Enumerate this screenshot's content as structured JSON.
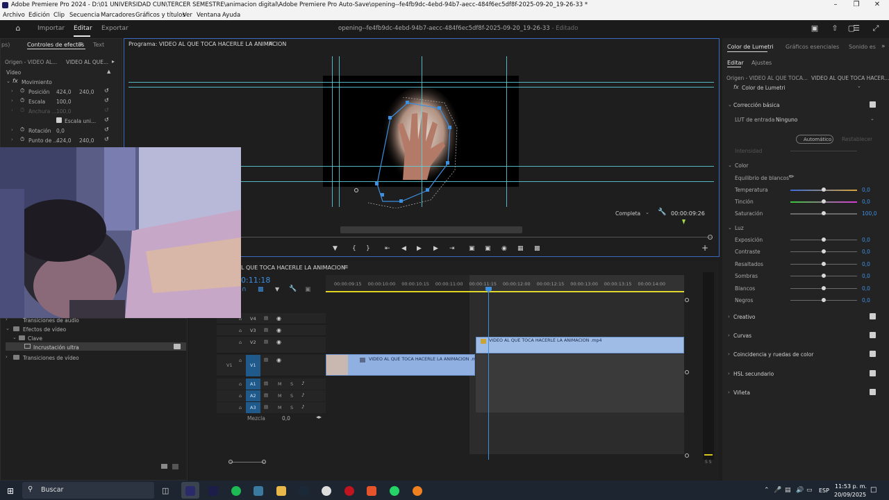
{
  "window": {
    "title": "Adobe Premiere Pro 2024 - D:\\01 UNIVERSIDAD CUN\\TERCER SEMESTRE\\animacion digital\\Adobe Premiere Pro Auto-Save\\opening--fe4fb9dc-4ebd-94b7-aecc-484f6ec5df8f-2025-09-20_19-26-33 *"
  },
  "menu": [
    "Archivo",
    "Edición",
    "Clip",
    "Secuencia",
    "Marcadores",
    "Gráficos y títulos",
    "Ver",
    "Ventana",
    "Ayuda"
  ],
  "header": {
    "workspaces": [
      "Importar",
      "Editar",
      "Exportar"
    ],
    "project_title": "opening--fe4fb9dc-4ebd-94b7-aecc-484f6ec5df8f-2025-09-20_19-26-33",
    "status": "- Editado"
  },
  "effect_controls": {
    "tab_left": "ps)",
    "tab_active": "Controles de efectos",
    "tab_other": "Text",
    "source": "Origen - VIDEO AL...",
    "source_seq": "VIDEO AL QUE...",
    "section": "Vídeo",
    "fx": "Movimiento",
    "rows": [
      {
        "label": "Posición",
        "v1": "424,0",
        "v2": "240,0"
      },
      {
        "label": "Escala",
        "v1": "100,0",
        "v2": ""
      },
      {
        "label": "Anchura ...",
        "v1": "100,0",
        "v2": ""
      },
      {
        "label": "Escala uni...",
        "v1": "",
        "v2": ""
      },
      {
        "label": "Rotación",
        "v1": "0,0",
        "v2": ""
      },
      {
        "label": "Punto de ...",
        "v1": "424,0",
        "v2": "240,0"
      }
    ]
  },
  "effects_tree": {
    "items": [
      {
        "label": "Transiciones de audio",
        "indent": 0
      },
      {
        "label": "Efectos de vídeo",
        "indent": 0
      },
      {
        "label": "Clave",
        "indent": 1
      },
      {
        "label": "Incrustación ultra",
        "indent": 2
      },
      {
        "label": "Transiciones de vídeo",
        "indent": 0
      }
    ]
  },
  "program": {
    "title": "Programa: VIDEO AL QUE TOCA HACERLE LA ANIMACION",
    "quality": "Completa",
    "timecode": "00:00:09:26"
  },
  "lumetri": {
    "tab_active": "Color de Lumetri",
    "tab2": "Gráficos esenciales",
    "tab3": "Sonido es",
    "sub_active": "Editar",
    "sub2": "Ajustes",
    "source": "Origen - VIDEO AL QUE TOCA...",
    "source_seq": "VIDEO AL QUE TOCA HACER...",
    "preset": "Color de Lumetri",
    "basic": "Corrección básica",
    "lut_label": "LUT de entrada",
    "lut_value": "Ninguno",
    "auto": "Automático",
    "reset": "Restablecer",
    "intensity": "Intensidad",
    "color_section": "Color",
    "wb": "Equilibrio de blancos",
    "color_rows": [
      {
        "label": "Temperatura",
        "value": "0,0",
        "knob": 0.5
      },
      {
        "label": "Tinción",
        "value": "0,0",
        "knob": 0.5
      },
      {
        "label": "Saturación",
        "value": "100,0",
        "knob": 0.5
      }
    ],
    "light_section": "Luz",
    "light_rows": [
      {
        "label": "Exposición",
        "value": "0,0"
      },
      {
        "label": "Contraste",
        "value": "0,0"
      },
      {
        "label": "Resaltados",
        "value": "0,0"
      },
      {
        "label": "Sombras",
        "value": "0,0"
      },
      {
        "label": "Blancos",
        "value": "0,0"
      },
      {
        "label": "Negros",
        "value": "0,0"
      }
    ],
    "sections": [
      "Creativo",
      "Curvas",
      "Coincidencia y ruedas de color",
      "HSL secundario",
      "Viñeta"
    ]
  },
  "timeline": {
    "tab": "L QUE TOCA HACERLE LA ANIMACION",
    "timecode": "0:11:18",
    "ruler": [
      "00:00:09:15",
      "00:00:10:00",
      "00:00:10:15",
      "00:00:11:00",
      "00:00:11:15",
      "00:00:12:00",
      "00:00:12:15",
      "00:00:13:00",
      "00:00:13:15",
      "00:00:14:00"
    ],
    "tracks_video": [
      "V4",
      "V3",
      "V2",
      "V1"
    ],
    "tracks_audio": [
      "A1",
      "A2",
      "A3"
    ],
    "v1_src": "V1",
    "clip_v1": "VIDEO AL QUE TOCA HACERLE LA ANIMACION .mp4",
    "clip_v2": "VIDEO AL QUE TOCA HACERLE LA ANIMACION .mp4",
    "mix_label": "Mezcla",
    "mix_value": "0,0",
    "meter_label": "S S"
  },
  "taskbar": {
    "search": "Buscar",
    "lang": "ESP",
    "time": "11:53 p. m.",
    "date": "20/09/2025"
  }
}
